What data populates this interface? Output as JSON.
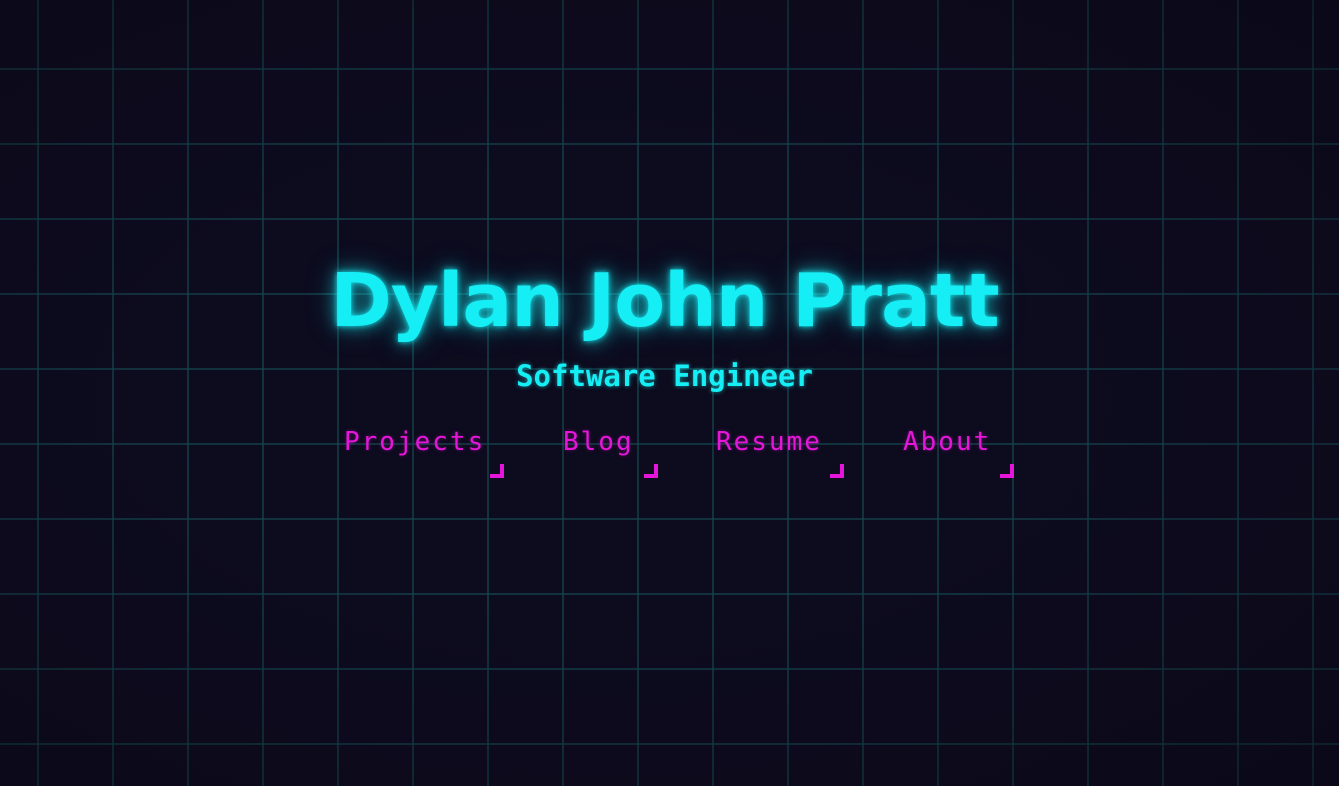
{
  "hero": {
    "name": "Dylan John Pratt",
    "subtitle": "Software Engineer"
  },
  "nav": {
    "items": [
      {
        "id": "projects",
        "label": "Projects"
      },
      {
        "id": "blog",
        "label": "Blog"
      },
      {
        "id": "resume",
        "label": "Resume"
      },
      {
        "id": "about",
        "label": "About"
      }
    ]
  },
  "colors": {
    "background": "#0d0b1e",
    "grid": "#144650",
    "accent_cyan": "#16eef5",
    "accent_magenta": "#e516d9"
  }
}
